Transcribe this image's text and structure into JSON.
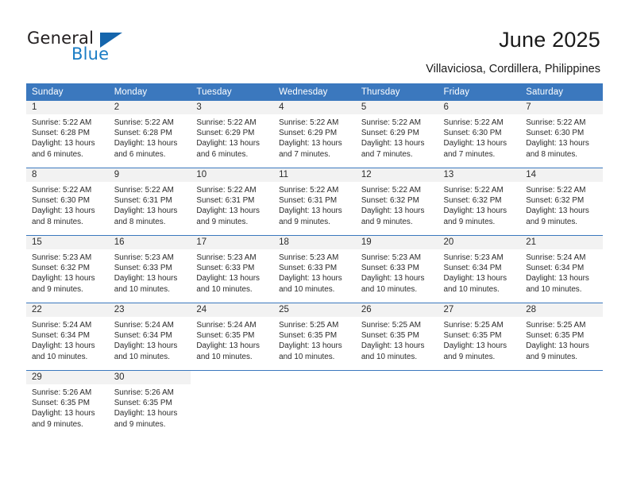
{
  "brand": {
    "name_part1": "General",
    "name_part2": "Blue",
    "triangle_color": "#1565ac",
    "blue_text_color": "#1a7cc4"
  },
  "header": {
    "title": "June 2025",
    "subtitle": "Villaviciosa, Cordillera, Philippines"
  },
  "theme": {
    "header_blue": "#3b78be",
    "day_band_gray": "#f2f2f2",
    "text_color": "#2b2b2b"
  },
  "weekdays": [
    "Sunday",
    "Monday",
    "Tuesday",
    "Wednesday",
    "Thursday",
    "Friday",
    "Saturday"
  ],
  "labels": {
    "sunrise_prefix": "Sunrise:",
    "sunset_prefix": "Sunset:",
    "daylight_prefix": "Daylight:"
  },
  "weeks": [
    [
      {
        "day": "1",
        "sunrise": "Sunrise: 5:22 AM",
        "sunset": "Sunset: 6:28 PM",
        "daylight_line1": "Daylight: 13 hours",
        "daylight_line2": "and 6 minutes."
      },
      {
        "day": "2",
        "sunrise": "Sunrise: 5:22 AM",
        "sunset": "Sunset: 6:28 PM",
        "daylight_line1": "Daylight: 13 hours",
        "daylight_line2": "and 6 minutes."
      },
      {
        "day": "3",
        "sunrise": "Sunrise: 5:22 AM",
        "sunset": "Sunset: 6:29 PM",
        "daylight_line1": "Daylight: 13 hours",
        "daylight_line2": "and 6 minutes."
      },
      {
        "day": "4",
        "sunrise": "Sunrise: 5:22 AM",
        "sunset": "Sunset: 6:29 PM",
        "daylight_line1": "Daylight: 13 hours",
        "daylight_line2": "and 7 minutes."
      },
      {
        "day": "5",
        "sunrise": "Sunrise: 5:22 AM",
        "sunset": "Sunset: 6:29 PM",
        "daylight_line1": "Daylight: 13 hours",
        "daylight_line2": "and 7 minutes."
      },
      {
        "day": "6",
        "sunrise": "Sunrise: 5:22 AM",
        "sunset": "Sunset: 6:30 PM",
        "daylight_line1": "Daylight: 13 hours",
        "daylight_line2": "and 7 minutes."
      },
      {
        "day": "7",
        "sunrise": "Sunrise: 5:22 AM",
        "sunset": "Sunset: 6:30 PM",
        "daylight_line1": "Daylight: 13 hours",
        "daylight_line2": "and 8 minutes."
      }
    ],
    [
      {
        "day": "8",
        "sunrise": "Sunrise: 5:22 AM",
        "sunset": "Sunset: 6:30 PM",
        "daylight_line1": "Daylight: 13 hours",
        "daylight_line2": "and 8 minutes."
      },
      {
        "day": "9",
        "sunrise": "Sunrise: 5:22 AM",
        "sunset": "Sunset: 6:31 PM",
        "daylight_line1": "Daylight: 13 hours",
        "daylight_line2": "and 8 minutes."
      },
      {
        "day": "10",
        "sunrise": "Sunrise: 5:22 AM",
        "sunset": "Sunset: 6:31 PM",
        "daylight_line1": "Daylight: 13 hours",
        "daylight_line2": "and 9 minutes."
      },
      {
        "day": "11",
        "sunrise": "Sunrise: 5:22 AM",
        "sunset": "Sunset: 6:31 PM",
        "daylight_line1": "Daylight: 13 hours",
        "daylight_line2": "and 9 minutes."
      },
      {
        "day": "12",
        "sunrise": "Sunrise: 5:22 AM",
        "sunset": "Sunset: 6:32 PM",
        "daylight_line1": "Daylight: 13 hours",
        "daylight_line2": "and 9 minutes."
      },
      {
        "day": "13",
        "sunrise": "Sunrise: 5:22 AM",
        "sunset": "Sunset: 6:32 PM",
        "daylight_line1": "Daylight: 13 hours",
        "daylight_line2": "and 9 minutes."
      },
      {
        "day": "14",
        "sunrise": "Sunrise: 5:22 AM",
        "sunset": "Sunset: 6:32 PM",
        "daylight_line1": "Daylight: 13 hours",
        "daylight_line2": "and 9 minutes."
      }
    ],
    [
      {
        "day": "15",
        "sunrise": "Sunrise: 5:23 AM",
        "sunset": "Sunset: 6:32 PM",
        "daylight_line1": "Daylight: 13 hours",
        "daylight_line2": "and 9 minutes."
      },
      {
        "day": "16",
        "sunrise": "Sunrise: 5:23 AM",
        "sunset": "Sunset: 6:33 PM",
        "daylight_line1": "Daylight: 13 hours",
        "daylight_line2": "and 10 minutes."
      },
      {
        "day": "17",
        "sunrise": "Sunrise: 5:23 AM",
        "sunset": "Sunset: 6:33 PM",
        "daylight_line1": "Daylight: 13 hours",
        "daylight_line2": "and 10 minutes."
      },
      {
        "day": "18",
        "sunrise": "Sunrise: 5:23 AM",
        "sunset": "Sunset: 6:33 PM",
        "daylight_line1": "Daylight: 13 hours",
        "daylight_line2": "and 10 minutes."
      },
      {
        "day": "19",
        "sunrise": "Sunrise: 5:23 AM",
        "sunset": "Sunset: 6:33 PM",
        "daylight_line1": "Daylight: 13 hours",
        "daylight_line2": "and 10 minutes."
      },
      {
        "day": "20",
        "sunrise": "Sunrise: 5:23 AM",
        "sunset": "Sunset: 6:34 PM",
        "daylight_line1": "Daylight: 13 hours",
        "daylight_line2": "and 10 minutes."
      },
      {
        "day": "21",
        "sunrise": "Sunrise: 5:24 AM",
        "sunset": "Sunset: 6:34 PM",
        "daylight_line1": "Daylight: 13 hours",
        "daylight_line2": "and 10 minutes."
      }
    ],
    [
      {
        "day": "22",
        "sunrise": "Sunrise: 5:24 AM",
        "sunset": "Sunset: 6:34 PM",
        "daylight_line1": "Daylight: 13 hours",
        "daylight_line2": "and 10 minutes."
      },
      {
        "day": "23",
        "sunrise": "Sunrise: 5:24 AM",
        "sunset": "Sunset: 6:34 PM",
        "daylight_line1": "Daylight: 13 hours",
        "daylight_line2": "and 10 minutes."
      },
      {
        "day": "24",
        "sunrise": "Sunrise: 5:24 AM",
        "sunset": "Sunset: 6:35 PM",
        "daylight_line1": "Daylight: 13 hours",
        "daylight_line2": "and 10 minutes."
      },
      {
        "day": "25",
        "sunrise": "Sunrise: 5:25 AM",
        "sunset": "Sunset: 6:35 PM",
        "daylight_line1": "Daylight: 13 hours",
        "daylight_line2": "and 10 minutes."
      },
      {
        "day": "26",
        "sunrise": "Sunrise: 5:25 AM",
        "sunset": "Sunset: 6:35 PM",
        "daylight_line1": "Daylight: 13 hours",
        "daylight_line2": "and 10 minutes."
      },
      {
        "day": "27",
        "sunrise": "Sunrise: 5:25 AM",
        "sunset": "Sunset: 6:35 PM",
        "daylight_line1": "Daylight: 13 hours",
        "daylight_line2": "and 9 minutes."
      },
      {
        "day": "28",
        "sunrise": "Sunrise: 5:25 AM",
        "sunset": "Sunset: 6:35 PM",
        "daylight_line1": "Daylight: 13 hours",
        "daylight_line2": "and 9 minutes."
      }
    ],
    [
      {
        "day": "29",
        "sunrise": "Sunrise: 5:26 AM",
        "sunset": "Sunset: 6:35 PM",
        "daylight_line1": "Daylight: 13 hours",
        "daylight_line2": "and 9 minutes."
      },
      {
        "day": "30",
        "sunrise": "Sunrise: 5:26 AM",
        "sunset": "Sunset: 6:35 PM",
        "daylight_line1": "Daylight: 13 hours",
        "daylight_line2": "and 9 minutes."
      },
      {
        "day": "",
        "sunrise": "",
        "sunset": "",
        "daylight_line1": "",
        "daylight_line2": ""
      },
      {
        "day": "",
        "sunrise": "",
        "sunset": "",
        "daylight_line1": "",
        "daylight_line2": ""
      },
      {
        "day": "",
        "sunrise": "",
        "sunset": "",
        "daylight_line1": "",
        "daylight_line2": ""
      },
      {
        "day": "",
        "sunrise": "",
        "sunset": "",
        "daylight_line1": "",
        "daylight_line2": ""
      },
      {
        "day": "",
        "sunrise": "",
        "sunset": "",
        "daylight_line1": "",
        "daylight_line2": ""
      }
    ]
  ]
}
